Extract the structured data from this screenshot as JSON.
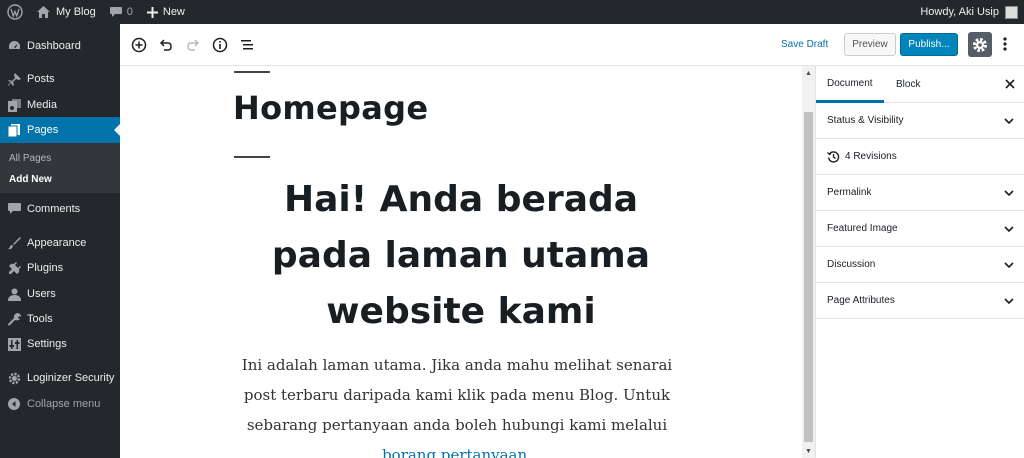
{
  "admin_bar": {
    "site_name": "My Blog",
    "comment_count": "0",
    "new_label": "New",
    "howdy": "Howdy, Aki Usip"
  },
  "sidebar": {
    "items": [
      {
        "label": "Dashboard",
        "icon": "dashboard-icon"
      },
      {
        "label": "Posts",
        "icon": "pin-icon"
      },
      {
        "label": "Media",
        "icon": "media-icon"
      },
      {
        "label": "Pages",
        "icon": "pages-icon"
      },
      {
        "label": "Comments",
        "icon": "comment-icon"
      },
      {
        "label": "Appearance",
        "icon": "brush-icon"
      },
      {
        "label": "Plugins",
        "icon": "plug-icon"
      },
      {
        "label": "Users",
        "icon": "user-icon"
      },
      {
        "label": "Tools",
        "icon": "wrench-icon"
      },
      {
        "label": "Settings",
        "icon": "settings-icon"
      },
      {
        "label": "Loginizer Security",
        "icon": "gear-icon"
      }
    ],
    "submenu": [
      {
        "label": "All Pages"
      },
      {
        "label": "Add New"
      }
    ],
    "collapse_label": "Collapse menu"
  },
  "toolbar": {
    "save_draft": "Save Draft",
    "preview": "Preview",
    "publish": "Publish..."
  },
  "content": {
    "page_title": "Homepage",
    "heading": "Hai! Anda berada pada laman utama website kami",
    "paragraph_text": "Ini adalah laman utama. Jika anda mahu melihat senarai post terbaru daripada kami klik pada menu Blog. Untuk sebarang pertanyaan anda boleh hubungi kami melalui ",
    "paragraph_link": "borang pertanyaan",
    "paragraph_end": "."
  },
  "settings_sidebar": {
    "tabs": [
      {
        "label": "Document"
      },
      {
        "label": "Block"
      }
    ],
    "panels": [
      {
        "label": "Status & Visibility"
      },
      {
        "label": "4 Revisions"
      },
      {
        "label": "Permalink"
      },
      {
        "label": "Featured Image"
      },
      {
        "label": "Discussion"
      },
      {
        "label": "Page Attributes"
      }
    ]
  },
  "colors": {
    "admin_dark": "#23282d",
    "accent_blue": "#0073aa",
    "publish_blue": "#0085ba"
  }
}
